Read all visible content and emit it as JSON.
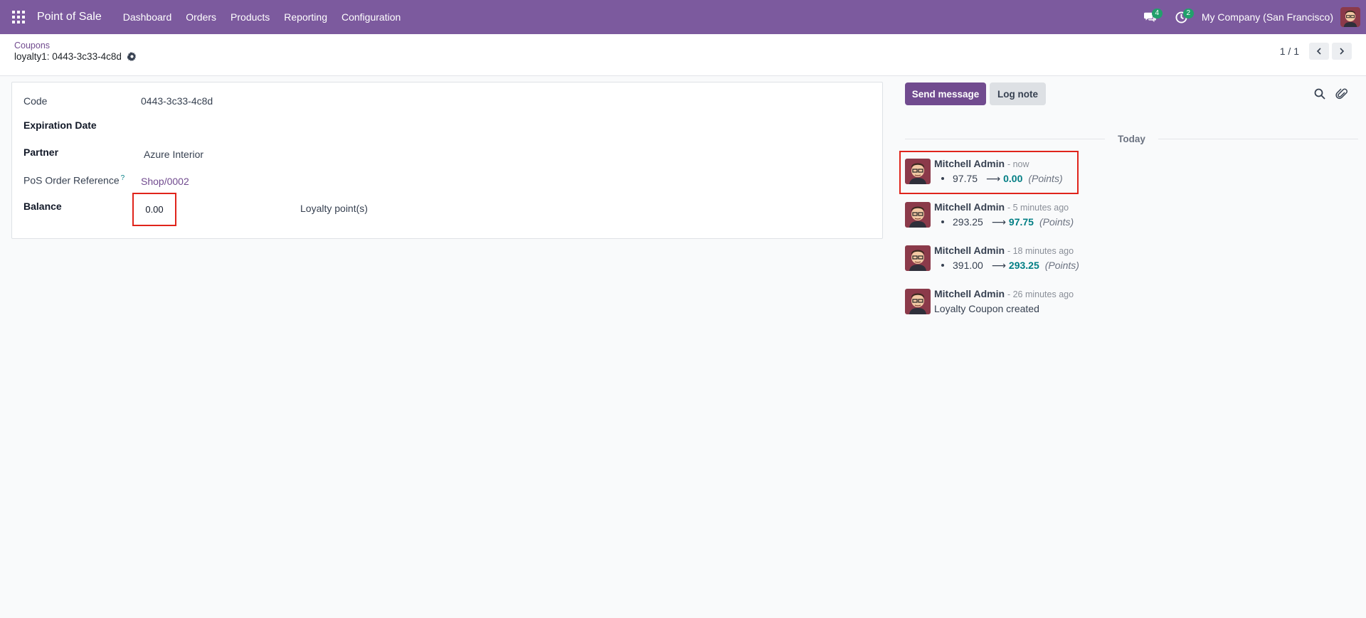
{
  "navbar": {
    "app_name": "Point of Sale",
    "menu": [
      "Dashboard",
      "Orders",
      "Products",
      "Reporting",
      "Configuration"
    ],
    "messages_badge": "4",
    "activities_badge": "2",
    "company": "My Company (San Francisco)",
    "bg_color": "#7c5a9e"
  },
  "breadcrumb": {
    "parent": "Coupons",
    "current": "loyalty1: 0443-3c33-4c8d"
  },
  "pager": {
    "value": "1 / 1"
  },
  "form": {
    "code_label": "Code",
    "code_value": "0443-3c33-4c8d",
    "expiration_label": "Expiration Date",
    "partner_label": "Partner",
    "partner_value": "Azure Interior",
    "pos_ref_label": "PoS Order Reference",
    "pos_ref_help": "?",
    "pos_ref_value": "Shop/0002",
    "balance_label": "Balance",
    "balance_value": "0.00",
    "balance_unit": "Loyalty point(s)"
  },
  "chatter": {
    "send_message": "Send message",
    "log_note": "Log note",
    "date_separator": "Today",
    "messages": [
      {
        "author": "Mitchell Admin",
        "date": "- now",
        "old": "97.75",
        "new": "0.00",
        "field": "(Points)"
      },
      {
        "author": "Mitchell Admin",
        "date": "- 5 minutes ago",
        "old": "293.25",
        "new": "97.75",
        "field": "(Points)"
      },
      {
        "author": "Mitchell Admin",
        "date": "- 18 minutes ago",
        "old": "391.00",
        "new": "293.25",
        "field": "(Points)"
      },
      {
        "author": "Mitchell Admin",
        "date": "- 26 minutes ago",
        "text": "Loyalty Coupon created"
      }
    ]
  },
  "icons": [
    "apps-grid-icon",
    "chat-bubbles-icon",
    "clock-icon",
    "gear-icon",
    "chevron-left-icon",
    "chevron-right-icon",
    "search-icon",
    "paperclip-icon",
    "avatar"
  ]
}
